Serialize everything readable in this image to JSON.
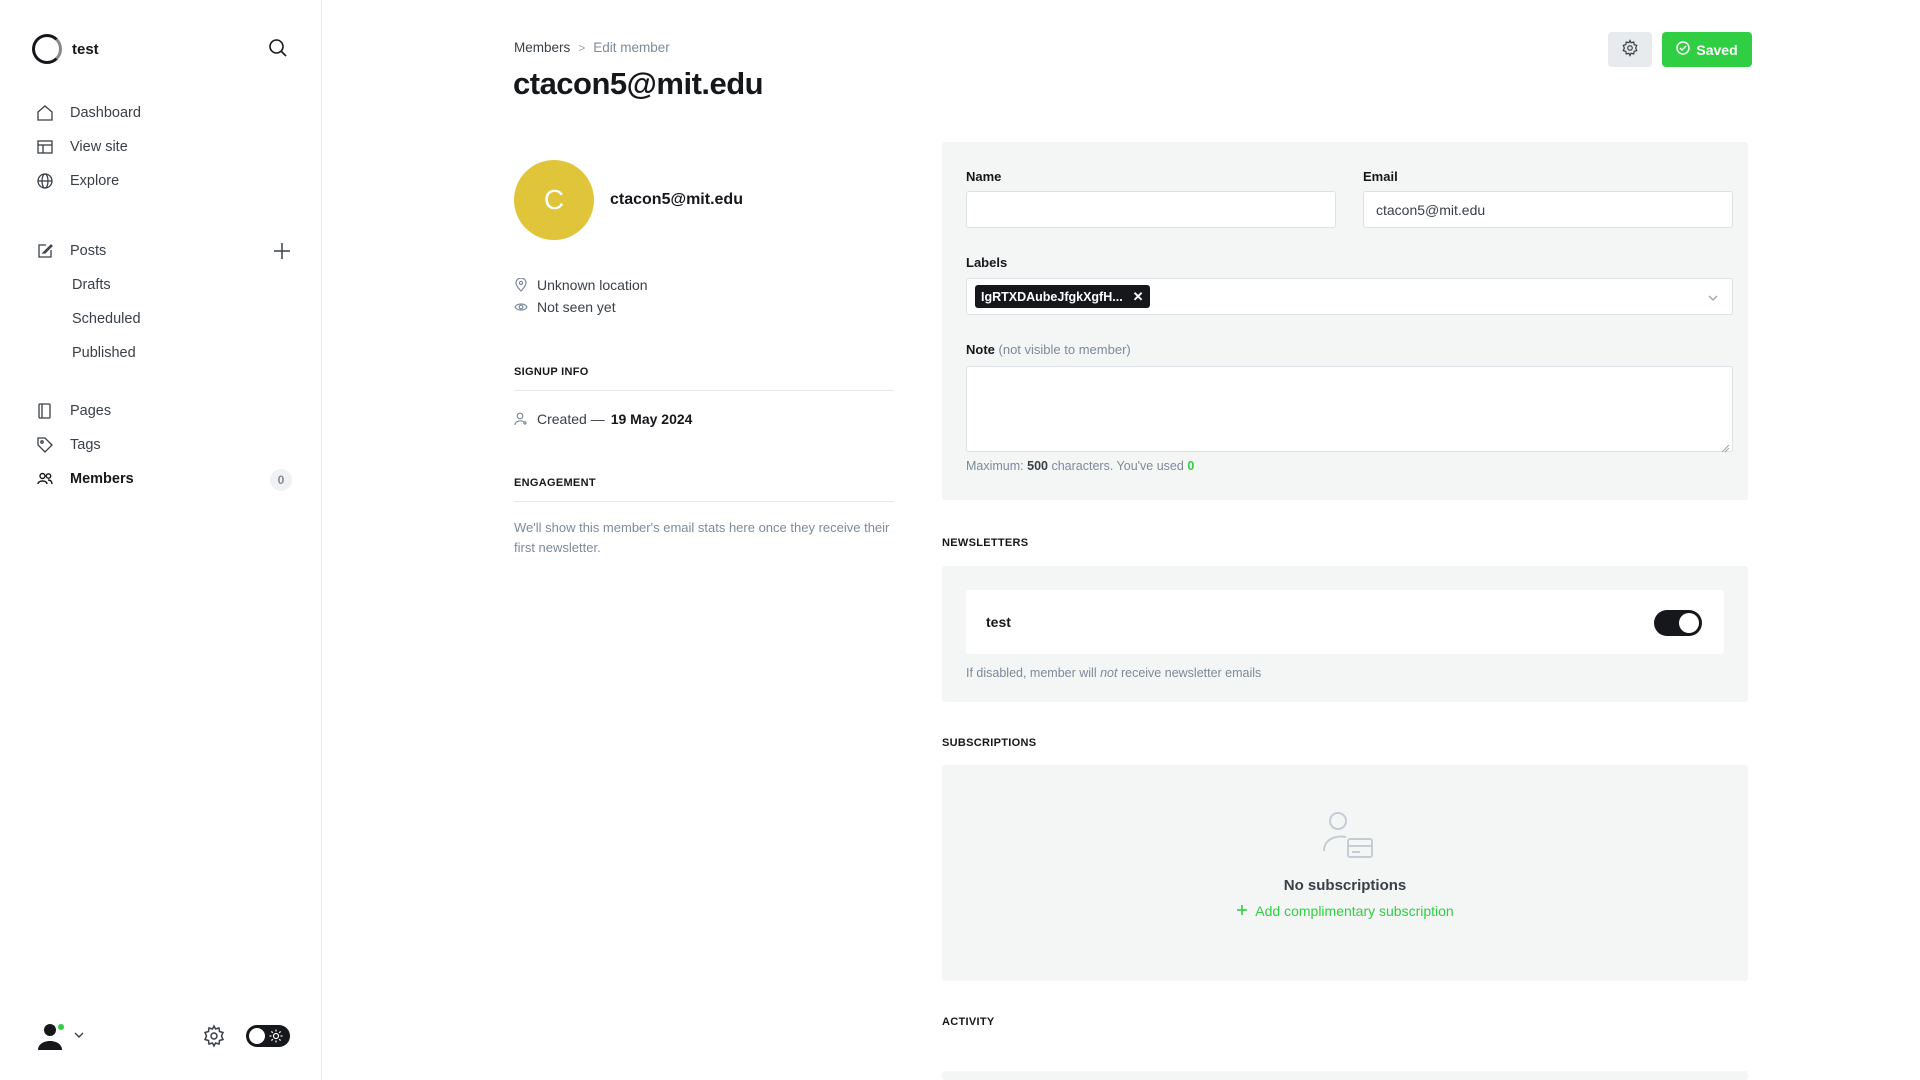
{
  "brand": {
    "name": "test"
  },
  "nav": {
    "dashboard": "Dashboard",
    "view_site": "View site",
    "explore": "Explore",
    "posts": "Posts",
    "drafts": "Drafts",
    "scheduled": "Scheduled",
    "published": "Published",
    "pages": "Pages",
    "tags": "Tags",
    "members": "Members",
    "members_count": "0"
  },
  "breadcrumb": {
    "parent": "Members",
    "separator": ">",
    "current": "Edit member"
  },
  "page": {
    "title": "ctacon5@mit.edu"
  },
  "actions": {
    "saved_label": "Saved"
  },
  "member": {
    "avatar_initial": "C",
    "avatar_color": "#e0c43a",
    "name": "ctacon5@mit.edu",
    "location": "Unknown location",
    "last_seen": "Not seen yet"
  },
  "signup": {
    "section": "Signup info",
    "created_prefix": "Created —",
    "created_date": "19 May 2024"
  },
  "engagement": {
    "section": "Engagement",
    "text": "We'll show this member's email stats here once they receive their first newsletter."
  },
  "form": {
    "name_label": "Name",
    "name_value": "",
    "email_label": "Email",
    "email_value": "ctacon5@mit.edu",
    "labels_label": "Labels",
    "label_chip": "IgRTXDAubeJfgkXgfH...",
    "note_label": "Note",
    "note_hint": "(not visible to member)",
    "note_value": "",
    "max_prefix": "Maximum:",
    "max_chars": "500",
    "max_suffix": "characters. You've used",
    "used_chars": "0"
  },
  "newsletters": {
    "section": "Newsletters",
    "items": [
      {
        "name": "test",
        "enabled": true
      }
    ],
    "hint_before": "If disabled, member will",
    "hint_em": "not",
    "hint_after": "receive newsletter emails"
  },
  "subscriptions": {
    "section": "Subscriptions",
    "empty_title": "No subscriptions",
    "add_label": "Add complimentary subscription"
  },
  "activity": {
    "section": "Activity"
  },
  "colors": {
    "accent": "#30cf43",
    "dark": "#15171a"
  }
}
